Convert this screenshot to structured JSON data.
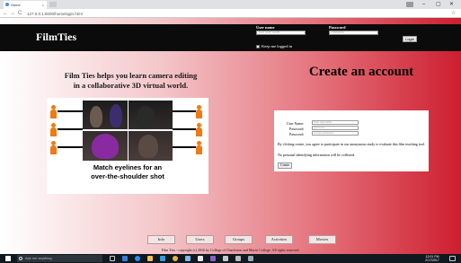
{
  "browser": {
    "tab_title": "Home",
    "tab_close": "×",
    "window_controls": {
      "minimize": "–",
      "maximize": "▢",
      "close": "✕"
    },
    "nav": {
      "back": "←",
      "forward": "→",
      "reload": "C"
    },
    "url": "127.0.0.1:8000/homelogin.html",
    "star": "☆"
  },
  "header": {
    "logo": "FilmTies",
    "username_label": "User name",
    "username_placeholder": "Your user name",
    "password_label": "Password",
    "password_placeholder": "Password",
    "keep_logged_in": "Keep me logged in",
    "login_button": "Login"
  },
  "hero": {
    "tagline_line1": "Film Ties helps you learn camera editing",
    "tagline_line2": "in a collaborative 3D virtual world.",
    "caption_line1": "Match eyelines for an",
    "caption_line2": "over-the-shoulder shot"
  },
  "signup": {
    "title": "Create an account",
    "user_name_label": "User Name:",
    "user_name_placeholder": "Your user name",
    "password_label": "Password:",
    "password_placeholder": "password",
    "password2_label": "Password:",
    "password2_placeholder": "re-type password",
    "consent_text": "By clicking create, you agree to participate in our anonymous study to evaluate this film teaching tool.",
    "privacy_text": "No personal identifying information will be collected.",
    "create_button": "Create"
  },
  "footer_nav": [
    "Info",
    "Users",
    "Groups",
    "Activities",
    "Movies"
  ],
  "copyright": "Film Ties - copyright (c) 2016 by College of Charleston and Marist College. All rights reserved.",
  "taskbar": {
    "search_text": "Ask me anything",
    "time": "12:01 PM",
    "date": "2/17/2017"
  },
  "colors": {
    "gradient_start": "#ffffff",
    "gradient_end": "#cd1e2f",
    "header_bg": "#0b0b0b",
    "figure_orange": "#f07a14"
  }
}
